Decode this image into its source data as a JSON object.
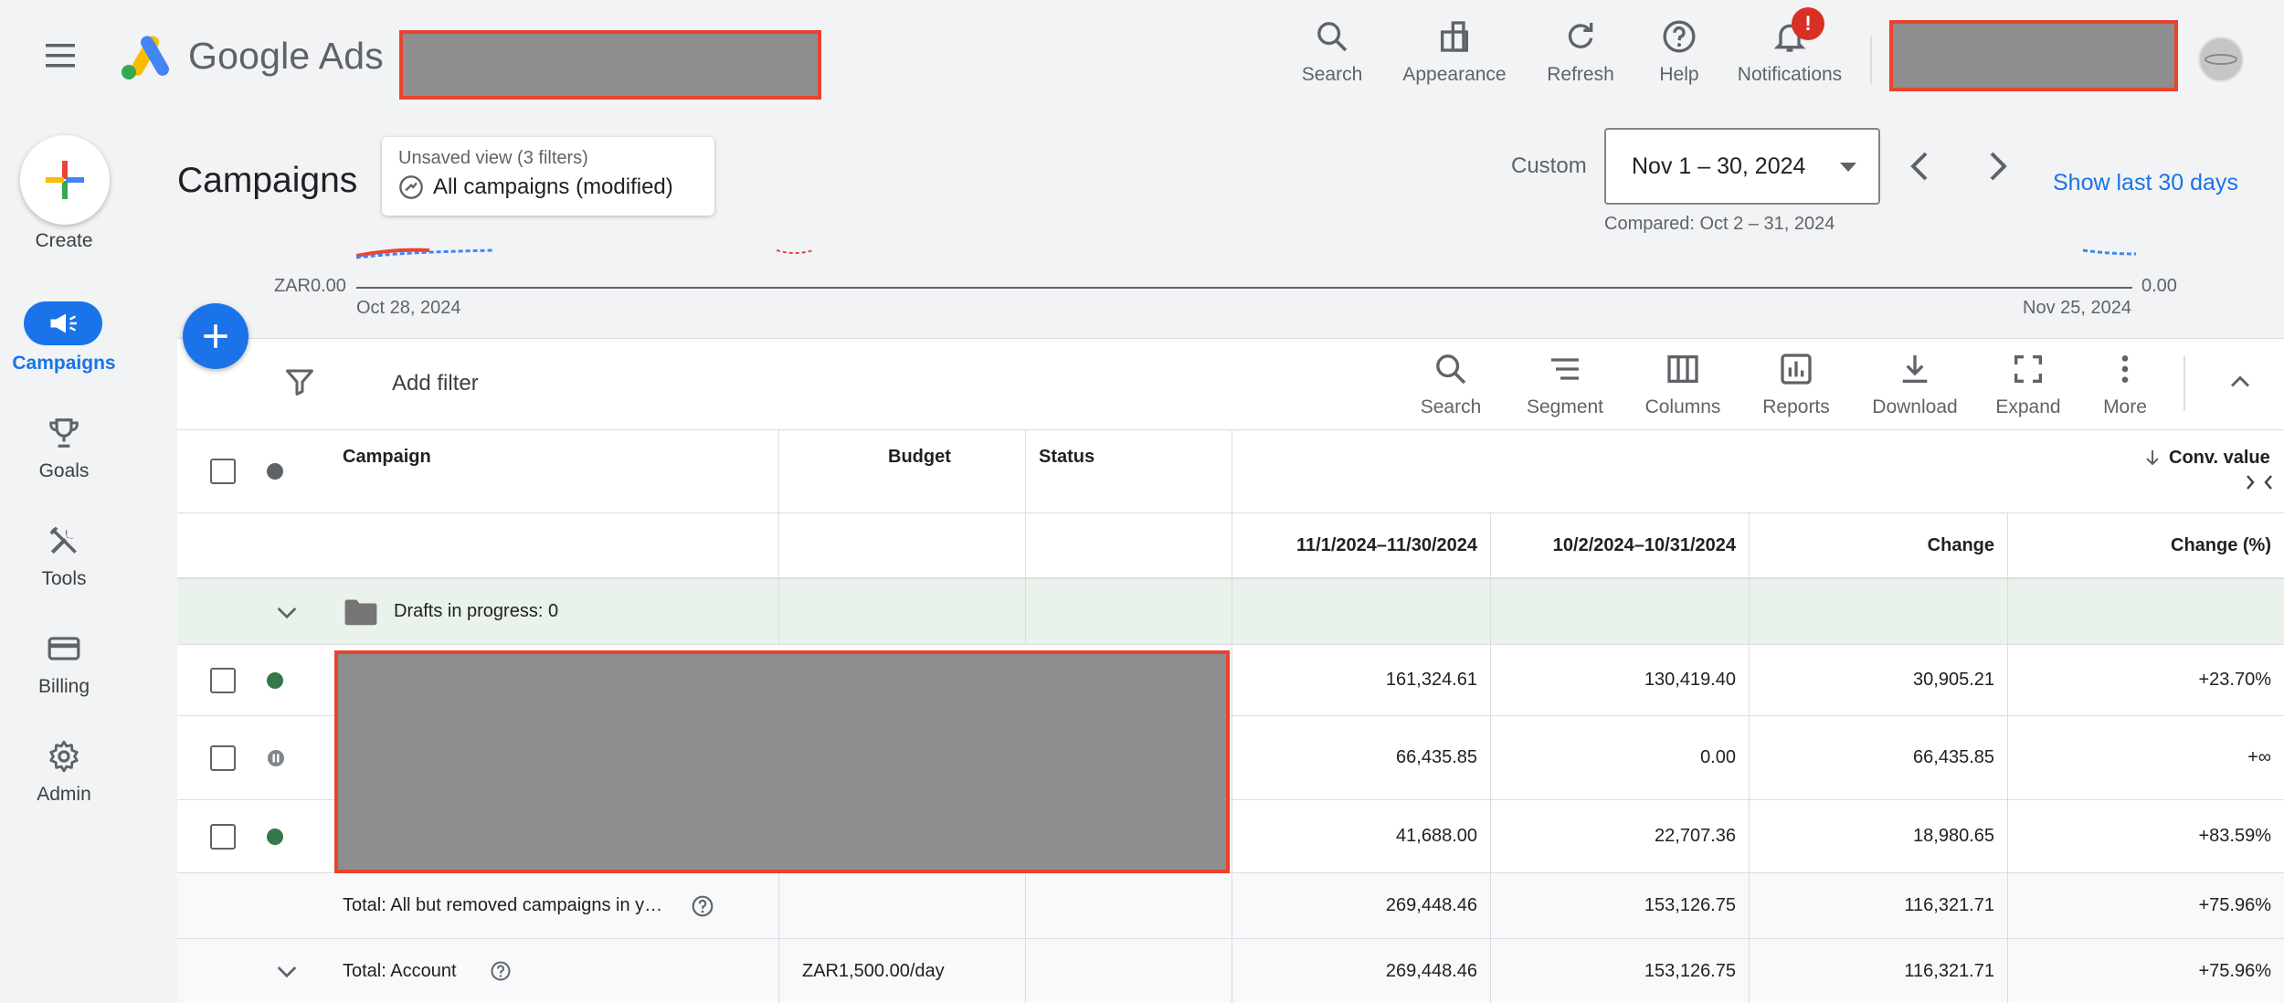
{
  "app": {
    "brand": "Google Ads"
  },
  "topnav": [
    {
      "id": "search",
      "label": "Search"
    },
    {
      "id": "appearance",
      "label": "Appearance"
    },
    {
      "id": "refresh",
      "label": "Refresh"
    },
    {
      "id": "help",
      "label": "Help"
    },
    {
      "id": "notifications",
      "label": "Notifications",
      "badge": "!"
    }
  ],
  "rail": {
    "create": "Create",
    "items": [
      {
        "id": "campaigns",
        "label": "Campaigns",
        "active": true
      },
      {
        "id": "goals",
        "label": "Goals"
      },
      {
        "id": "tools",
        "label": "Tools"
      },
      {
        "id": "billing",
        "label": "Billing"
      },
      {
        "id": "admin",
        "label": "Admin"
      }
    ]
  },
  "header": {
    "title": "Campaigns",
    "view_sub": "Unsaved view (3 filters)",
    "view_name": "All campaigns (modified)",
    "custom_label": "Custom",
    "date_range": "Nov 1 – 30, 2024",
    "compared": "Compared: Oct 2 – 31, 2024",
    "show_last": "Show last 30 days"
  },
  "chart": {
    "y_left": "ZAR0.00",
    "y_right": "0.00",
    "x_start": "Oct 28, 2024",
    "x_end": "Nov 25, 2024"
  },
  "toolbar": {
    "add_filter": "Add filter",
    "items": [
      {
        "id": "search",
        "label": "Search"
      },
      {
        "id": "segment",
        "label": "Segment"
      },
      {
        "id": "columns",
        "label": "Columns"
      },
      {
        "id": "reports",
        "label": "Reports"
      },
      {
        "id": "download",
        "label": "Download"
      },
      {
        "id": "expand",
        "label": "Expand"
      },
      {
        "id": "more",
        "label": "More"
      }
    ]
  },
  "table": {
    "headers": {
      "campaign": "Campaign",
      "budget": "Budget",
      "status": "Status",
      "metric": "Conv. value",
      "period_current": "11/1/2024–11/30/2024",
      "period_previous": "10/2/2024–10/31/2024",
      "change": "Change",
      "change_pct": "Change (%)"
    },
    "drafts": "Drafts in progress: 0",
    "rows": [
      {
        "status": "enabled",
        "current": "161,324.61",
        "previous": "130,419.40",
        "change": "30,905.21",
        "pct": "+23.70%"
      },
      {
        "status": "paused",
        "current": "66,435.85",
        "previous": "0.00",
        "change": "66,435.85",
        "pct": "+∞"
      },
      {
        "status": "enabled",
        "current": "41,688.00",
        "previous": "22,707.36",
        "change": "18,980.65",
        "pct": "+83.59%"
      }
    ],
    "total_filtered": {
      "label": "Total: All but removed campaigns in y…",
      "current": "269,448.46",
      "previous": "153,126.75",
      "change": "116,321.71",
      "pct": "+75.96%"
    },
    "total_account": {
      "label": "Total: Account",
      "budget": "ZAR1,500.00/day",
      "current": "269,448.46",
      "previous": "153,126.75",
      "change": "116,321.71",
      "pct": "+75.96%"
    }
  }
}
